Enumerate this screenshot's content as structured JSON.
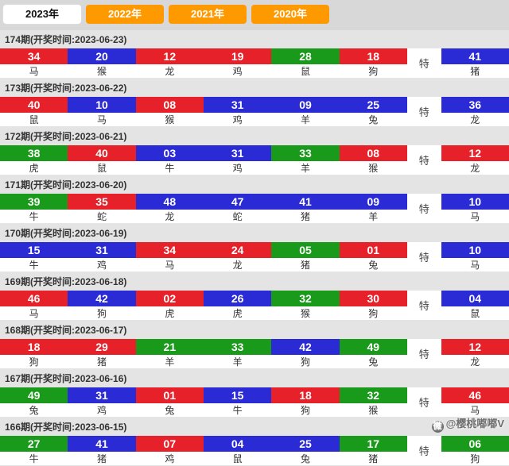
{
  "tabs": [
    {
      "label": "2023年",
      "active": true
    },
    {
      "label": "2022年",
      "active": false
    },
    {
      "label": "2021年",
      "active": false
    },
    {
      "label": "2020年",
      "active": false
    }
  ],
  "te_label": "特",
  "periods": [
    {
      "id": "174",
      "date": "2023-06-23",
      "balls": [
        {
          "n": "34",
          "c": "red",
          "z": "马"
        },
        {
          "n": "20",
          "c": "blue",
          "z": "猴"
        },
        {
          "n": "12",
          "c": "red",
          "z": "龙"
        },
        {
          "n": "19",
          "c": "red",
          "z": "鸡"
        },
        {
          "n": "28",
          "c": "green",
          "z": "鼠"
        },
        {
          "n": "18",
          "c": "red",
          "z": "狗"
        }
      ],
      "special": {
        "n": "41",
        "c": "blue",
        "z": "猪"
      }
    },
    {
      "id": "173",
      "date": "2023-06-22",
      "balls": [
        {
          "n": "40",
          "c": "red",
          "z": "鼠"
        },
        {
          "n": "10",
          "c": "blue",
          "z": "马"
        },
        {
          "n": "08",
          "c": "red",
          "z": "猴"
        },
        {
          "n": "31",
          "c": "blue",
          "z": "鸡"
        },
        {
          "n": "09",
          "c": "blue",
          "z": "羊"
        },
        {
          "n": "25",
          "c": "blue",
          "z": "兔"
        }
      ],
      "special": {
        "n": "36",
        "c": "blue",
        "z": "龙"
      }
    },
    {
      "id": "172",
      "date": "2023-06-21",
      "balls": [
        {
          "n": "38",
          "c": "green",
          "z": "虎"
        },
        {
          "n": "40",
          "c": "red",
          "z": "鼠"
        },
        {
          "n": "03",
          "c": "blue",
          "z": "牛"
        },
        {
          "n": "31",
          "c": "blue",
          "z": "鸡"
        },
        {
          "n": "33",
          "c": "green",
          "z": "羊"
        },
        {
          "n": "08",
          "c": "red",
          "z": "猴"
        }
      ],
      "special": {
        "n": "12",
        "c": "red",
        "z": "龙"
      }
    },
    {
      "id": "171",
      "date": "2023-06-20",
      "balls": [
        {
          "n": "39",
          "c": "green",
          "z": "牛"
        },
        {
          "n": "35",
          "c": "red",
          "z": "蛇"
        },
        {
          "n": "48",
          "c": "blue",
          "z": "龙"
        },
        {
          "n": "47",
          "c": "blue",
          "z": "蛇"
        },
        {
          "n": "41",
          "c": "blue",
          "z": "猪"
        },
        {
          "n": "09",
          "c": "blue",
          "z": "羊"
        }
      ],
      "special": {
        "n": "10",
        "c": "blue",
        "z": "马"
      }
    },
    {
      "id": "170",
      "date": "2023-06-19",
      "balls": [
        {
          "n": "15",
          "c": "blue",
          "z": "牛"
        },
        {
          "n": "31",
          "c": "blue",
          "z": "鸡"
        },
        {
          "n": "34",
          "c": "red",
          "z": "马"
        },
        {
          "n": "24",
          "c": "red",
          "z": "龙"
        },
        {
          "n": "05",
          "c": "green",
          "z": "猪"
        },
        {
          "n": "01",
          "c": "red",
          "z": "兔"
        }
      ],
      "special": {
        "n": "10",
        "c": "blue",
        "z": "马"
      }
    },
    {
      "id": "169",
      "date": "2023-06-18",
      "balls": [
        {
          "n": "46",
          "c": "red",
          "z": "马"
        },
        {
          "n": "42",
          "c": "blue",
          "z": "狗"
        },
        {
          "n": "02",
          "c": "red",
          "z": "虎"
        },
        {
          "n": "26",
          "c": "blue",
          "z": "虎"
        },
        {
          "n": "32",
          "c": "green",
          "z": "猴"
        },
        {
          "n": "30",
          "c": "red",
          "z": "狗"
        }
      ],
      "special": {
        "n": "04",
        "c": "blue",
        "z": "鼠"
      }
    },
    {
      "id": "168",
      "date": "2023-06-17",
      "balls": [
        {
          "n": "18",
          "c": "red",
          "z": "狗"
        },
        {
          "n": "29",
          "c": "red",
          "z": "猪"
        },
        {
          "n": "21",
          "c": "green",
          "z": "羊"
        },
        {
          "n": "33",
          "c": "green",
          "z": "羊"
        },
        {
          "n": "42",
          "c": "blue",
          "z": "狗"
        },
        {
          "n": "49",
          "c": "green",
          "z": "兔"
        }
      ],
      "special": {
        "n": "12",
        "c": "red",
        "z": "龙"
      }
    },
    {
      "id": "167",
      "date": "2023-06-16",
      "balls": [
        {
          "n": "49",
          "c": "green",
          "z": "兔"
        },
        {
          "n": "31",
          "c": "blue",
          "z": "鸡"
        },
        {
          "n": "01",
          "c": "red",
          "z": "兔"
        },
        {
          "n": "15",
          "c": "blue",
          "z": "牛"
        },
        {
          "n": "18",
          "c": "red",
          "z": "狗"
        },
        {
          "n": "32",
          "c": "green",
          "z": "猴"
        }
      ],
      "special": {
        "n": "46",
        "c": "red",
        "z": "马"
      }
    },
    {
      "id": "166",
      "date": "2023-06-15",
      "balls": [
        {
          "n": "27",
          "c": "green",
          "z": "牛"
        },
        {
          "n": "41",
          "c": "blue",
          "z": "猪"
        },
        {
          "n": "07",
          "c": "red",
          "z": "鸡"
        },
        {
          "n": "04",
          "c": "blue",
          "z": "鼠"
        },
        {
          "n": "25",
          "c": "blue",
          "z": "兔"
        },
        {
          "n": "17",
          "c": "green",
          "z": "猪"
        }
      ],
      "special": {
        "n": "06",
        "c": "green",
        "z": "狗"
      }
    }
  ],
  "watermark": "@樱桃嘟嘟V"
}
